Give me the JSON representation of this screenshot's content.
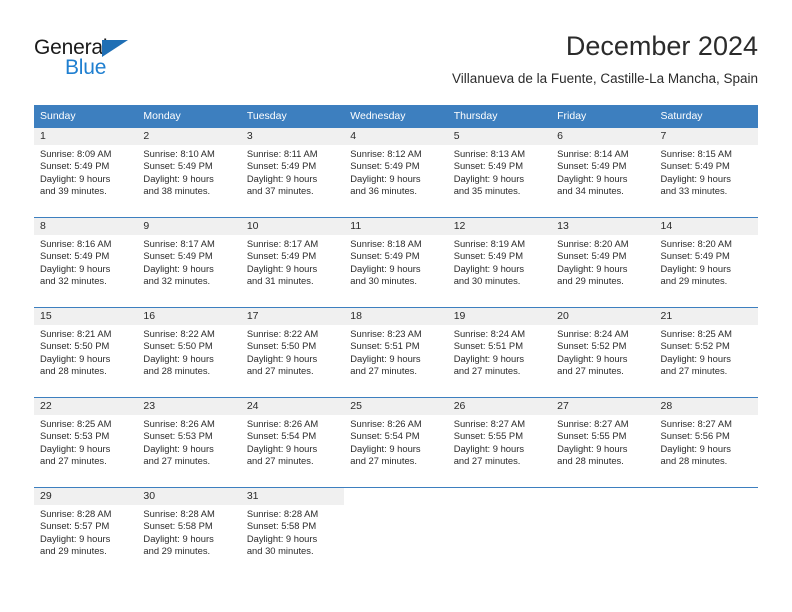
{
  "logo": {
    "word_top": "General",
    "word_bottom": "Blue",
    "triangle_color": "#1f6fb5",
    "blue_color": "#1f7fd0"
  },
  "header": {
    "title": "December 2024",
    "subtitle": "Villanueva de la Fuente, Castille-La Mancha, Spain"
  },
  "theme": {
    "header_row_bg": "#3d7fbf",
    "daynum_bg": "#f0f0f0",
    "grid_line": "#3d7fbf",
    "text": "#2b2b2b"
  },
  "weekday_headers": [
    "Sunday",
    "Monday",
    "Tuesday",
    "Wednesday",
    "Thursday",
    "Friday",
    "Saturday"
  ],
  "weeks": [
    [
      {
        "day": "1",
        "sunrise": "Sunrise: 8:09 AM",
        "sunset": "Sunset: 5:49 PM",
        "daylight_line1": "Daylight: 9 hours",
        "daylight_line2": "and 39 minutes."
      },
      {
        "day": "2",
        "sunrise": "Sunrise: 8:10 AM",
        "sunset": "Sunset: 5:49 PM",
        "daylight_line1": "Daylight: 9 hours",
        "daylight_line2": "and 38 minutes."
      },
      {
        "day": "3",
        "sunrise": "Sunrise: 8:11 AM",
        "sunset": "Sunset: 5:49 PM",
        "daylight_line1": "Daylight: 9 hours",
        "daylight_line2": "and 37 minutes."
      },
      {
        "day": "4",
        "sunrise": "Sunrise: 8:12 AM",
        "sunset": "Sunset: 5:49 PM",
        "daylight_line1": "Daylight: 9 hours",
        "daylight_line2": "and 36 minutes."
      },
      {
        "day": "5",
        "sunrise": "Sunrise: 8:13 AM",
        "sunset": "Sunset: 5:49 PM",
        "daylight_line1": "Daylight: 9 hours",
        "daylight_line2": "and 35 minutes."
      },
      {
        "day": "6",
        "sunrise": "Sunrise: 8:14 AM",
        "sunset": "Sunset: 5:49 PM",
        "daylight_line1": "Daylight: 9 hours",
        "daylight_line2": "and 34 minutes."
      },
      {
        "day": "7",
        "sunrise": "Sunrise: 8:15 AM",
        "sunset": "Sunset: 5:49 PM",
        "daylight_line1": "Daylight: 9 hours",
        "daylight_line2": "and 33 minutes."
      }
    ],
    [
      {
        "day": "8",
        "sunrise": "Sunrise: 8:16 AM",
        "sunset": "Sunset: 5:49 PM",
        "daylight_line1": "Daylight: 9 hours",
        "daylight_line2": "and 32 minutes."
      },
      {
        "day": "9",
        "sunrise": "Sunrise: 8:17 AM",
        "sunset": "Sunset: 5:49 PM",
        "daylight_line1": "Daylight: 9 hours",
        "daylight_line2": "and 32 minutes."
      },
      {
        "day": "10",
        "sunrise": "Sunrise: 8:17 AM",
        "sunset": "Sunset: 5:49 PM",
        "daylight_line1": "Daylight: 9 hours",
        "daylight_line2": "and 31 minutes."
      },
      {
        "day": "11",
        "sunrise": "Sunrise: 8:18 AM",
        "sunset": "Sunset: 5:49 PM",
        "daylight_line1": "Daylight: 9 hours",
        "daylight_line2": "and 30 minutes."
      },
      {
        "day": "12",
        "sunrise": "Sunrise: 8:19 AM",
        "sunset": "Sunset: 5:49 PM",
        "daylight_line1": "Daylight: 9 hours",
        "daylight_line2": "and 30 minutes."
      },
      {
        "day": "13",
        "sunrise": "Sunrise: 8:20 AM",
        "sunset": "Sunset: 5:49 PM",
        "daylight_line1": "Daylight: 9 hours",
        "daylight_line2": "and 29 minutes."
      },
      {
        "day": "14",
        "sunrise": "Sunrise: 8:20 AM",
        "sunset": "Sunset: 5:49 PM",
        "daylight_line1": "Daylight: 9 hours",
        "daylight_line2": "and 29 minutes."
      }
    ],
    [
      {
        "day": "15",
        "sunrise": "Sunrise: 8:21 AM",
        "sunset": "Sunset: 5:50 PM",
        "daylight_line1": "Daylight: 9 hours",
        "daylight_line2": "and 28 minutes."
      },
      {
        "day": "16",
        "sunrise": "Sunrise: 8:22 AM",
        "sunset": "Sunset: 5:50 PM",
        "daylight_line1": "Daylight: 9 hours",
        "daylight_line2": "and 28 minutes."
      },
      {
        "day": "17",
        "sunrise": "Sunrise: 8:22 AM",
        "sunset": "Sunset: 5:50 PM",
        "daylight_line1": "Daylight: 9 hours",
        "daylight_line2": "and 27 minutes."
      },
      {
        "day": "18",
        "sunrise": "Sunrise: 8:23 AM",
        "sunset": "Sunset: 5:51 PM",
        "daylight_line1": "Daylight: 9 hours",
        "daylight_line2": "and 27 minutes."
      },
      {
        "day": "19",
        "sunrise": "Sunrise: 8:24 AM",
        "sunset": "Sunset: 5:51 PM",
        "daylight_line1": "Daylight: 9 hours",
        "daylight_line2": "and 27 minutes."
      },
      {
        "day": "20",
        "sunrise": "Sunrise: 8:24 AM",
        "sunset": "Sunset: 5:52 PM",
        "daylight_line1": "Daylight: 9 hours",
        "daylight_line2": "and 27 minutes."
      },
      {
        "day": "21",
        "sunrise": "Sunrise: 8:25 AM",
        "sunset": "Sunset: 5:52 PM",
        "daylight_line1": "Daylight: 9 hours",
        "daylight_line2": "and 27 minutes."
      }
    ],
    [
      {
        "day": "22",
        "sunrise": "Sunrise: 8:25 AM",
        "sunset": "Sunset: 5:53 PM",
        "daylight_line1": "Daylight: 9 hours",
        "daylight_line2": "and 27 minutes."
      },
      {
        "day": "23",
        "sunrise": "Sunrise: 8:26 AM",
        "sunset": "Sunset: 5:53 PM",
        "daylight_line1": "Daylight: 9 hours",
        "daylight_line2": "and 27 minutes."
      },
      {
        "day": "24",
        "sunrise": "Sunrise: 8:26 AM",
        "sunset": "Sunset: 5:54 PM",
        "daylight_line1": "Daylight: 9 hours",
        "daylight_line2": "and 27 minutes."
      },
      {
        "day": "25",
        "sunrise": "Sunrise: 8:26 AM",
        "sunset": "Sunset: 5:54 PM",
        "daylight_line1": "Daylight: 9 hours",
        "daylight_line2": "and 27 minutes."
      },
      {
        "day": "26",
        "sunrise": "Sunrise: 8:27 AM",
        "sunset": "Sunset: 5:55 PM",
        "daylight_line1": "Daylight: 9 hours",
        "daylight_line2": "and 27 minutes."
      },
      {
        "day": "27",
        "sunrise": "Sunrise: 8:27 AM",
        "sunset": "Sunset: 5:55 PM",
        "daylight_line1": "Daylight: 9 hours",
        "daylight_line2": "and 28 minutes."
      },
      {
        "day": "28",
        "sunrise": "Sunrise: 8:27 AM",
        "sunset": "Sunset: 5:56 PM",
        "daylight_line1": "Daylight: 9 hours",
        "daylight_line2": "and 28 minutes."
      }
    ],
    [
      {
        "day": "29",
        "sunrise": "Sunrise: 8:28 AM",
        "sunset": "Sunset: 5:57 PM",
        "daylight_line1": "Daylight: 9 hours",
        "daylight_line2": "and 29 minutes."
      },
      {
        "day": "30",
        "sunrise": "Sunrise: 8:28 AM",
        "sunset": "Sunset: 5:58 PM",
        "daylight_line1": "Daylight: 9 hours",
        "daylight_line2": "and 29 minutes."
      },
      {
        "day": "31",
        "sunrise": "Sunrise: 8:28 AM",
        "sunset": "Sunset: 5:58 PM",
        "daylight_line1": "Daylight: 9 hours",
        "daylight_line2": "and 30 minutes."
      },
      {
        "day": "",
        "sunrise": "",
        "sunset": "",
        "daylight_line1": "",
        "daylight_line2": ""
      },
      {
        "day": "",
        "sunrise": "",
        "sunset": "",
        "daylight_line1": "",
        "daylight_line2": ""
      },
      {
        "day": "",
        "sunrise": "",
        "sunset": "",
        "daylight_line1": "",
        "daylight_line2": ""
      },
      {
        "day": "",
        "sunrise": "",
        "sunset": "",
        "daylight_line1": "",
        "daylight_line2": ""
      }
    ]
  ]
}
